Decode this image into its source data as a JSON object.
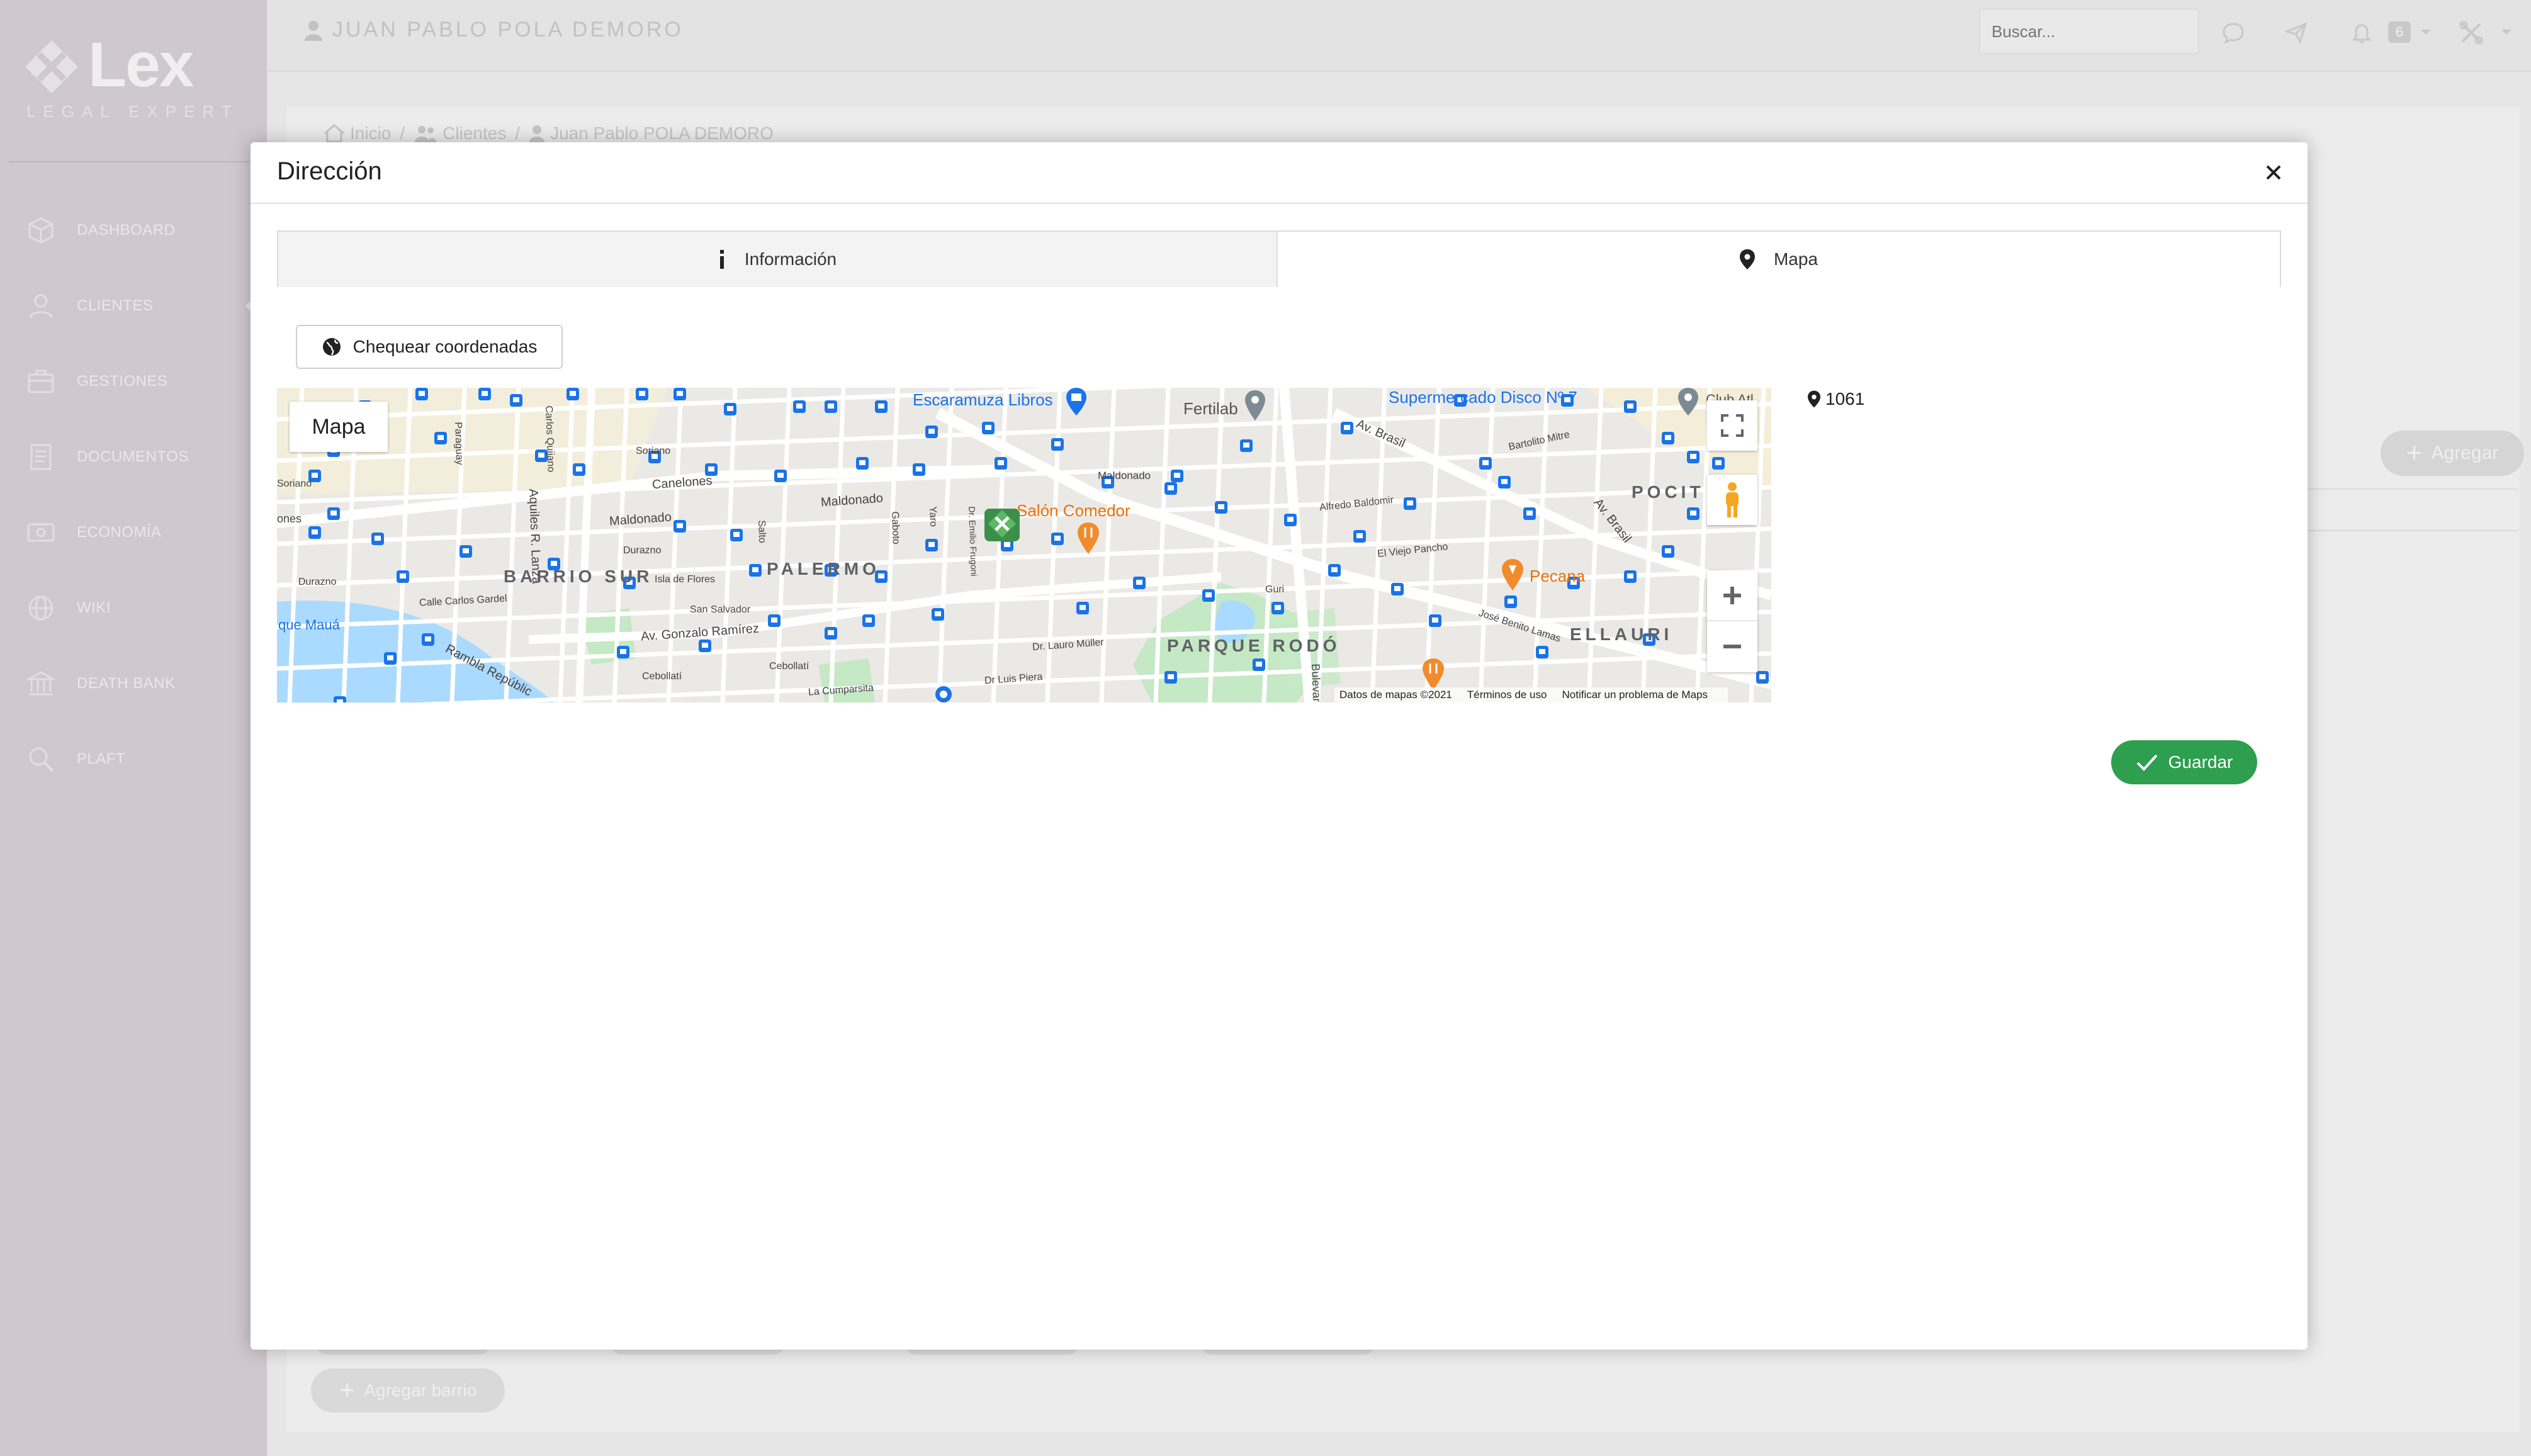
{
  "app": {
    "brand": "Lex",
    "brand_sub": "LEGAL EXPERT"
  },
  "sidebar": {
    "items": [
      {
        "label": "DASHBOARD",
        "icon": "cube-icon"
      },
      {
        "label": "CLIENTES",
        "icon": "user-icon"
      },
      {
        "label": "GESTIONES",
        "icon": "briefcase-icon"
      },
      {
        "label": "DOCUMENTOS",
        "icon": "document-icon"
      },
      {
        "label": "ECONOMÍA",
        "icon": "money-icon"
      },
      {
        "label": "WIKI",
        "icon": "globe-icon"
      },
      {
        "label": "DEATH BANK",
        "icon": "bank-icon"
      },
      {
        "label": "PLAFT",
        "icon": "search-icon"
      }
    ]
  },
  "header": {
    "user_name": "JUAN PABLO POLA DEMORO",
    "search_placeholder": "Buscar...",
    "notification_count": "6"
  },
  "breadcrumb": {
    "home": "Inicio",
    "section": "Clientes",
    "current": "Juan Pablo POLA DEMORO"
  },
  "background": {
    "agregar_label": "Agregar",
    "agregar_barrio_label": "Agregar barrio"
  },
  "modal": {
    "title": "Dirección",
    "tabs": [
      {
        "label": "Información",
        "icon": "info-icon"
      },
      {
        "label": "Mapa",
        "icon": "map-marker-icon"
      }
    ],
    "chequear_label": "Chequear coordenadas",
    "map_type_label": "Mapa",
    "coord_value": "1061",
    "guardar_label": "Guardar"
  },
  "map": {
    "places": [
      "Escaramuza Libros",
      "Fertilab",
      "Supermercado Disco Nº 7",
      "Club Atl",
      "Salón Comedor",
      "Pecana"
    ],
    "districts": [
      "BARRIO SUR",
      "PALERMO",
      "PARQUE RODÓ",
      "ELLAURI",
      "POCIT"
    ],
    "streets": [
      "Maldonado",
      "Maldonado",
      "Maldonado",
      "Canelones",
      "Soriano",
      "Soriano",
      "Durazno",
      "Durazno",
      "Isla de Flores",
      "San Salvador",
      "Calle Carlos Gardel",
      "Av. Gonzalo Ramírez",
      "Rambla Repúblic",
      "Cebollatí",
      "Cebollatí",
      "La Cumparsita",
      "Dr. Lauro Müller",
      "Dr Luis Piera",
      "Av. Brasil",
      "Av. Brasil",
      "Bartolito Mitre",
      "Alfredo Baldomir",
      "El Viejo Pancho",
      "José Benito Lamas",
      "Aquiles R. Lanza",
      "Carlos Quijano",
      "Paraguay",
      "Salto",
      "Gaboto",
      "Yaro",
      "Dr. Emilio Frugoni",
      "Guri",
      "Bulevar",
      "que Mauá",
      "ones"
    ],
    "footer": {
      "data": "Datos de mapas ©2021",
      "terms": "Términos de uso",
      "report": "Notificar un problema de Maps"
    },
    "colors": {
      "water": "#aadaff",
      "park": "#c5e8c5",
      "road": "#ffffff",
      "arterial": "#fde293",
      "transit": "#1a73e8",
      "food": "#f28b2c",
      "label_blue": "#1a73e8",
      "label_orange": "#e8710a"
    }
  },
  "colors": {
    "sidebar_bg": "#cfc8cd",
    "save_green": "#2e9e4f",
    "overlay_gray": "#e6e6e6"
  }
}
